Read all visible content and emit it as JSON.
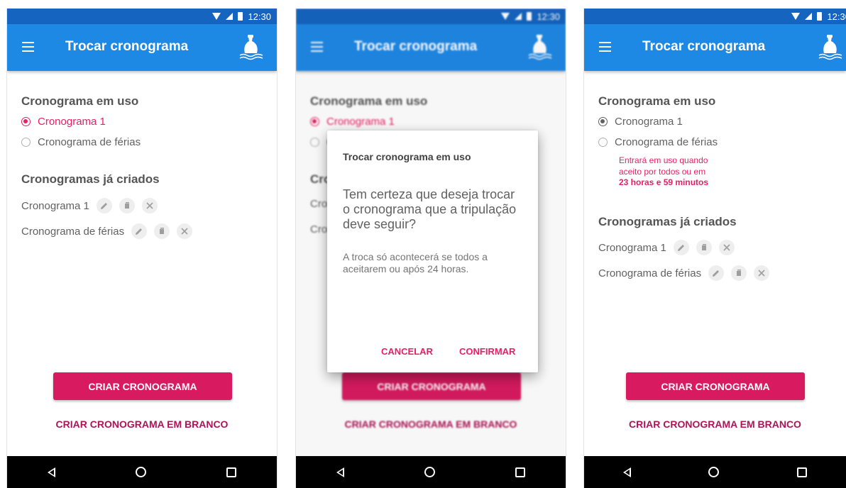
{
  "status": {
    "time": "12:30"
  },
  "appbar": {
    "title": "Trocar cronograma",
    "menu_icon": "menu-icon",
    "logo_icon": "bottle-logo-icon"
  },
  "current": {
    "title": "Cronograma em uso",
    "options": [
      {
        "label": "Cronograma 1"
      },
      {
        "label": "Cronograma de férias"
      }
    ]
  },
  "created": {
    "title": "Cronogramas já criados",
    "items": [
      {
        "name": "Cronograma 1"
      },
      {
        "name": "Cronograma de férias"
      }
    ],
    "actions": [
      "edit-icon",
      "copy-icon",
      "delete-icon"
    ]
  },
  "buttons": {
    "create": "CRIAR CRONOGRAMA",
    "create_blank": "CRIAR CRONOGRAMA EM BRANCO"
  },
  "dialog": {
    "title": "Trocar cronograma em uso",
    "question": "Tem certeza que deseja trocar o cronograma que a tripulação deve seguir?",
    "note": "A troca só acontecerá se todos a aceitarem ou após 24 horas.",
    "cancel": "CANCELAR",
    "confirm": "CONFIRMAR"
  },
  "pending": {
    "line1": "Entrará em uso quando",
    "line2": "aceito por todos ou em",
    "line3": "23 horas e 59 minutos"
  },
  "navbar": {
    "icons": [
      "back-icon",
      "home-icon",
      "recents-icon"
    ]
  },
  "colors": {
    "statusbar": "#1565c0",
    "appbar": "#1e88e5",
    "accent": "#e91e63",
    "button": "#d81b60",
    "link": "#ad1457"
  }
}
